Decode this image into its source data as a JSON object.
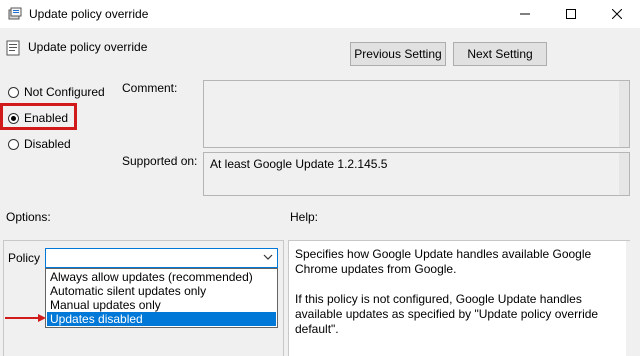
{
  "window": {
    "title": "Update policy override",
    "controls": {
      "minimize": "—",
      "maximize": "☐",
      "close": "✕"
    }
  },
  "header": {
    "title": "Update policy override",
    "prev_button": "Previous Setting",
    "next_button": "Next Setting"
  },
  "state": {
    "options": [
      {
        "label": "Not Configured",
        "selected": false
      },
      {
        "label": "Enabled",
        "selected": true
      },
      {
        "label": "Disabled",
        "selected": false
      }
    ]
  },
  "comment": {
    "label": "Comment:",
    "value": ""
  },
  "supported": {
    "label": "Supported on:",
    "value": "At least Google Update 1.2.145.5"
  },
  "options_section": {
    "label": "Options:",
    "policy_label": "Policy",
    "selected_value": "",
    "dropdown_items": [
      {
        "label": "Always allow updates (recommended)",
        "highlighted": false
      },
      {
        "label": "Automatic silent updates only",
        "highlighted": false
      },
      {
        "label": "Manual updates only",
        "highlighted": false
      },
      {
        "label": "Updates disabled",
        "highlighted": true
      }
    ]
  },
  "help_section": {
    "label": "Help:",
    "paragraphs": [
      "Specifies how Google Update handles available Google Chrome updates from Google.",
      "If this policy is not configured, Google Update handles available updates as specified by \"Update policy override default\"."
    ]
  },
  "colors": {
    "annotation_red": "#d11a1a",
    "selection_blue": "#0078d7"
  }
}
